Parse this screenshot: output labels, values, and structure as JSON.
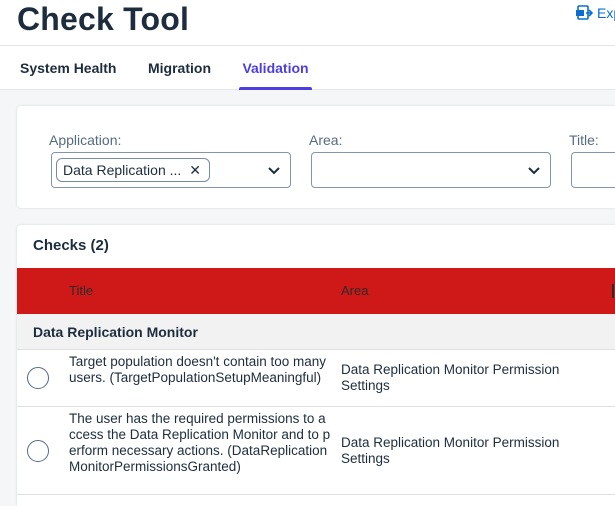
{
  "header": {
    "title": "Check Tool",
    "export_label": "Exp"
  },
  "tabs": [
    {
      "label": "System Health"
    },
    {
      "label": "Migration"
    },
    {
      "label": "Validation"
    }
  ],
  "filters": {
    "application": {
      "label": "Application:",
      "token": "Data Replication ..."
    },
    "area": {
      "label": "Area:"
    },
    "title": {
      "label": "Title:"
    }
  },
  "checks": {
    "heading": "Checks (2)",
    "columns": {
      "title": "Title",
      "area": "Area"
    },
    "group": "Data Replication Monitor",
    "rows": [
      {
        "title": "Target population doesn't contain too many users. (TargetPopulationSetupMeaningful)",
        "area": "Data Replication Monitor Permission Settings"
      },
      {
        "title": "The user has the required permissions to access the Data Replication Monitor and to perform necessary actions. (DataReplicationMonitorPermissionsGranted)",
        "area": "Data Replication Monitor Permission Settings"
      }
    ]
  },
  "colors": {
    "accent": "#4c3ee0",
    "header_row": "#cf1818",
    "link": "#0a6ed1"
  }
}
